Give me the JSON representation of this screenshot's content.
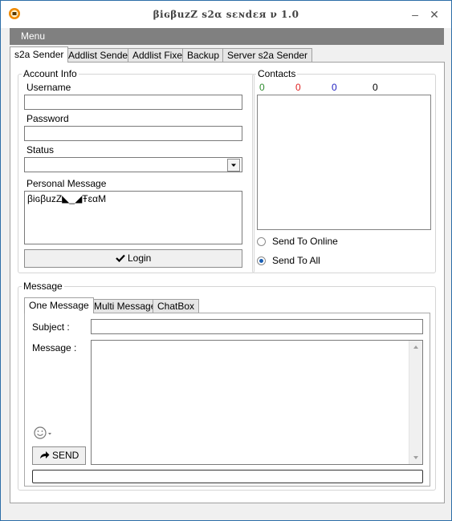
{
  "window": {
    "title": "βiɢβuzZ s2α sɛɴdɛя ν 1.0",
    "minimize_glyph": "–",
    "close_glyph": "✕"
  },
  "menubar": {
    "menu_label": "Menu"
  },
  "main_tabs": [
    "s2a Sender",
    "Addlist Sender",
    "Addlist Fixer",
    "Backup",
    "Server s2a Sender"
  ],
  "account": {
    "legend": "Account Info",
    "username_label": "Username",
    "username_value": "",
    "password_label": "Password",
    "password_value": "",
    "status_label": "Status",
    "status_value": "",
    "personal_message_label": "Personal Message",
    "personal_message_value": "βiɢβuzZ◣_◢ŦɛαM",
    "login_label": "Login"
  },
  "contacts": {
    "legend": "Contacts",
    "counts": [
      {
        "value": "0",
        "color": "#2e8b2e"
      },
      {
        "value": "0",
        "color": "#e02020"
      },
      {
        "value": "0",
        "color": "#2020c0"
      },
      {
        "value": "0",
        "color": "#000000"
      }
    ],
    "send_to_online_label": "Send To Online",
    "send_to_all_label": "Send To All",
    "selected": "Send To All"
  },
  "message": {
    "legend": "Message",
    "tabs": [
      "One Message",
      "Multi Message",
      "ChatBox"
    ],
    "subject_label": "Subject :",
    "subject_value": "",
    "message_label": "Message :",
    "message_value": "",
    "send_label": "SEND",
    "emoji_icon": "smiley-icon"
  }
}
